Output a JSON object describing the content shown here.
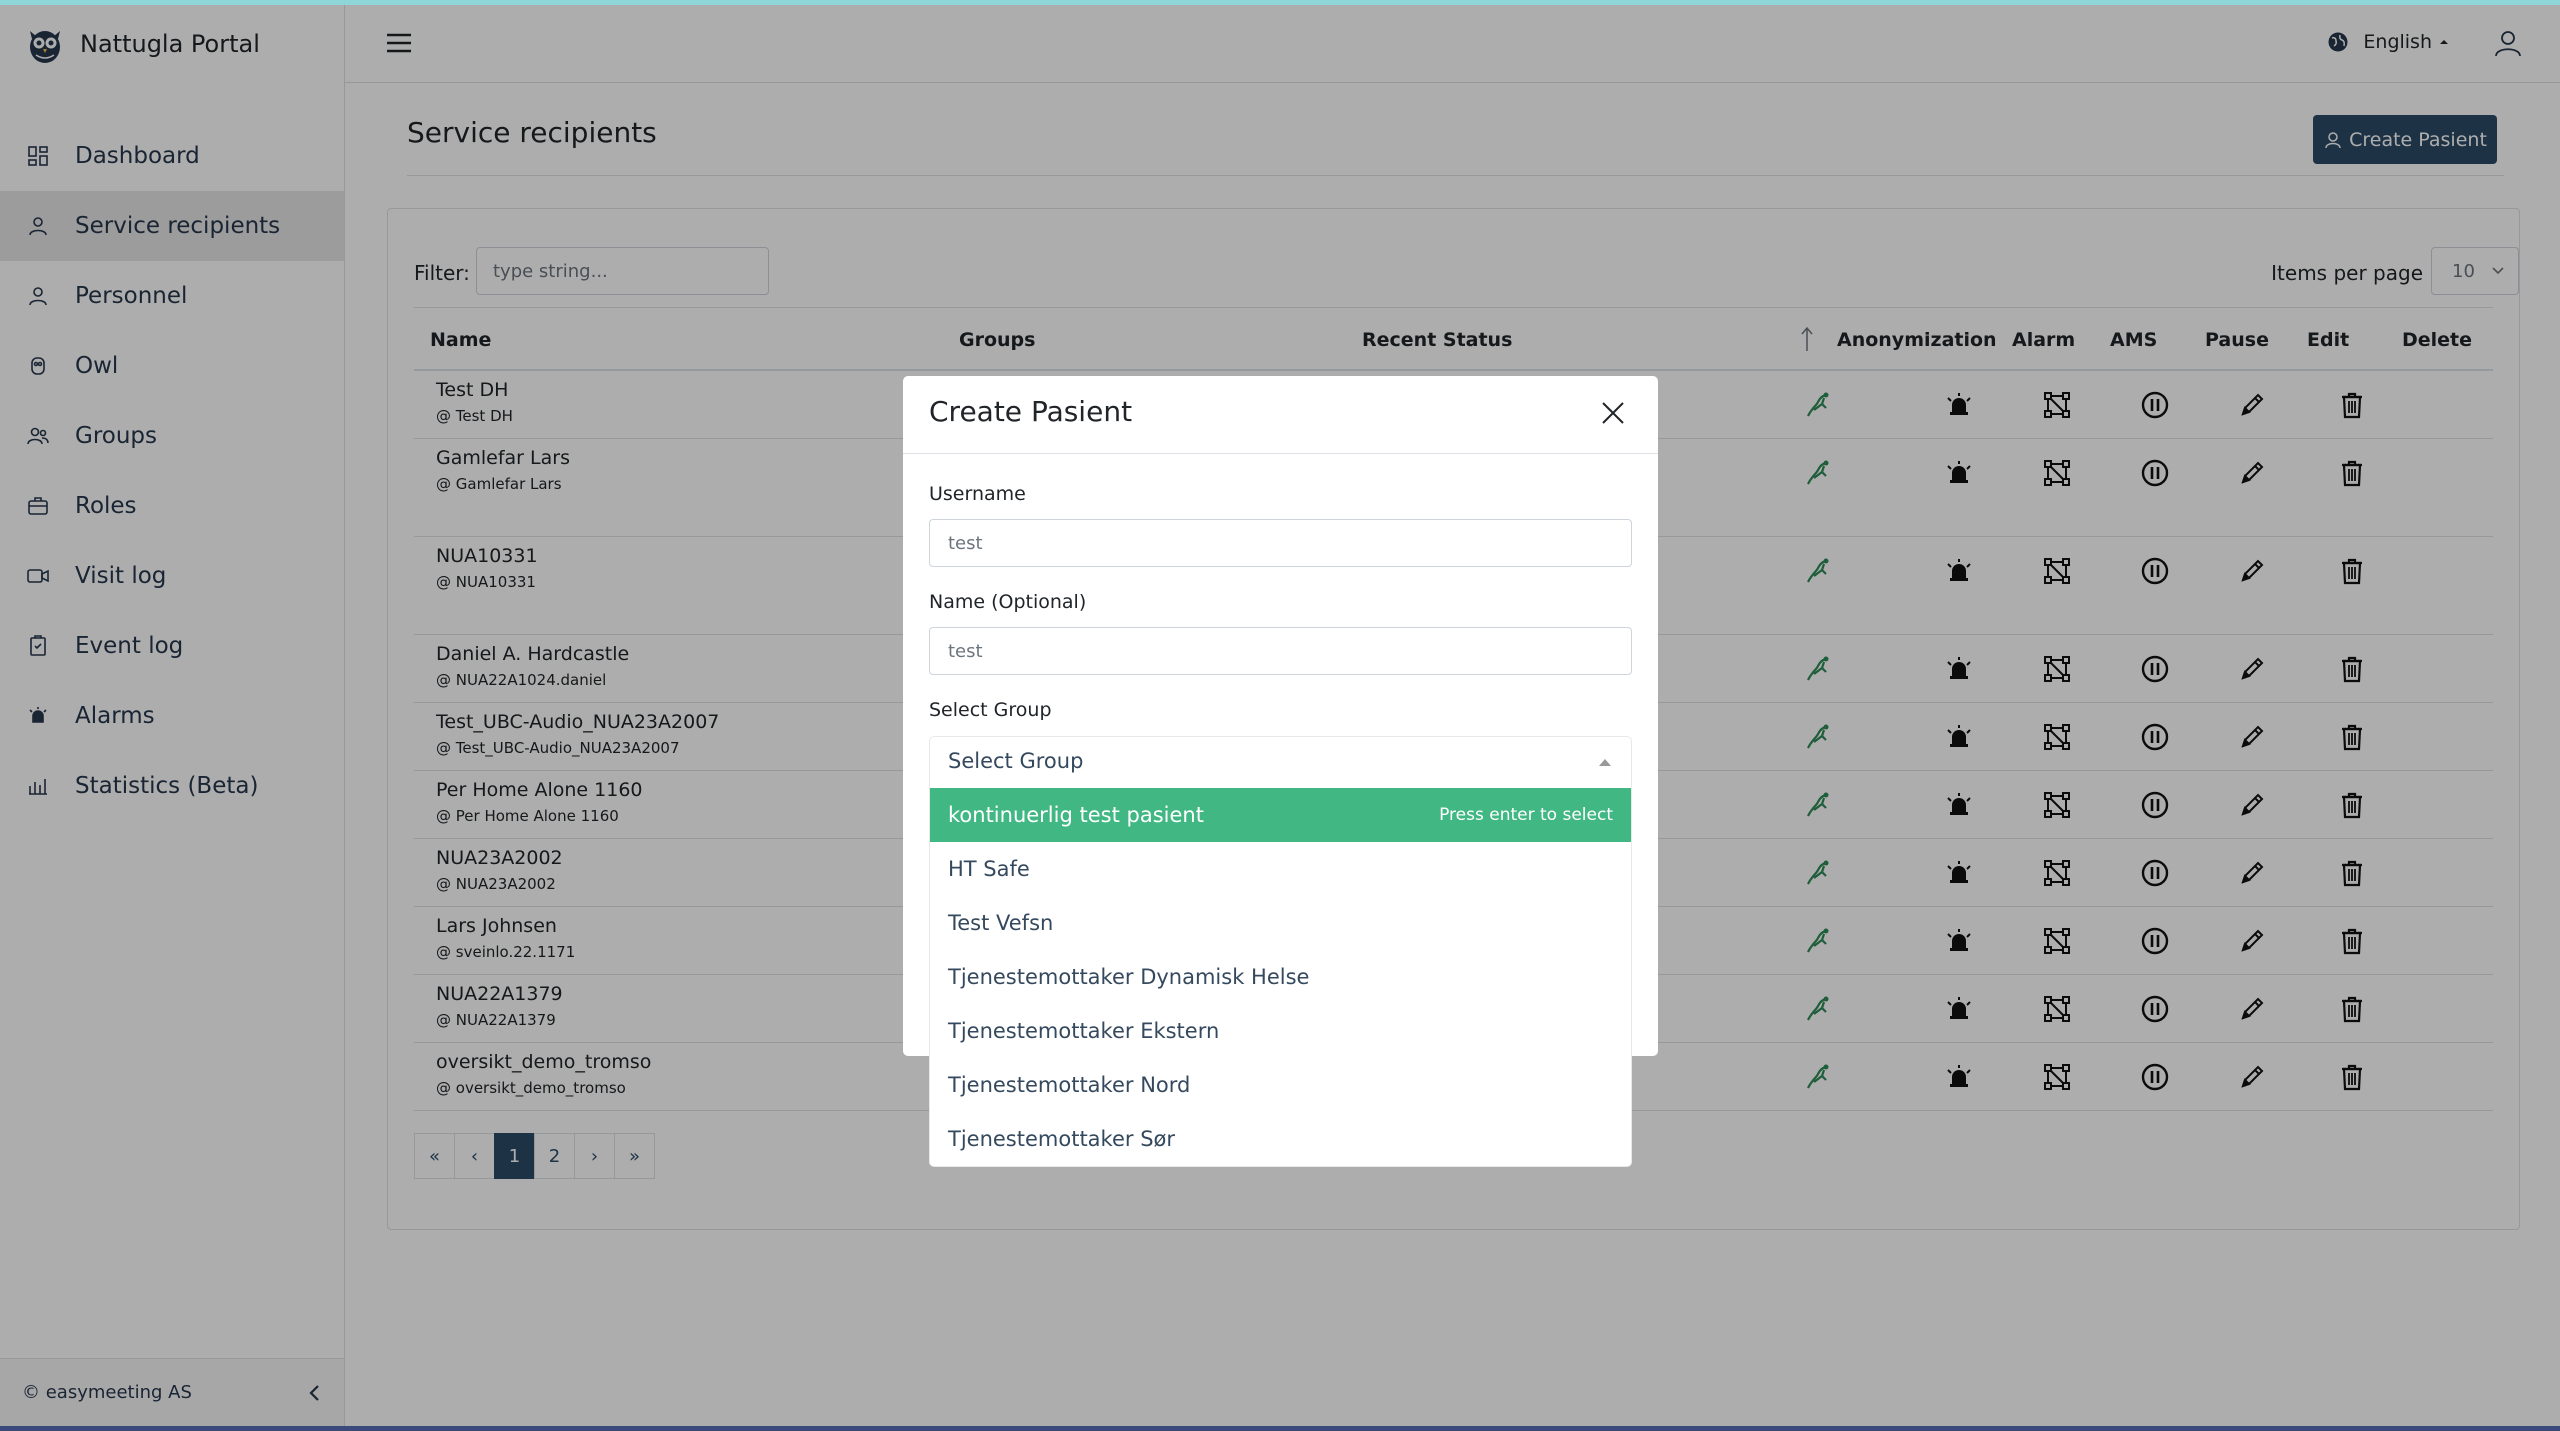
{
  "app": {
    "brand": "Nattugla Portal",
    "footer": "© easymeeting AS"
  },
  "sidebar": {
    "items": [
      {
        "label": "Dashboard",
        "icon": "dashboard-icon"
      },
      {
        "label": "Service recipients",
        "icon": "person-icon",
        "active": true
      },
      {
        "label": "Personnel",
        "icon": "person-icon"
      },
      {
        "label": "Owl",
        "icon": "owl-icon"
      },
      {
        "label": "Groups",
        "icon": "group-icon"
      },
      {
        "label": "Roles",
        "icon": "briefcase-icon"
      },
      {
        "label": "Visit log",
        "icon": "video-icon"
      },
      {
        "label": "Event log",
        "icon": "clipboard-icon"
      },
      {
        "label": "Alarms",
        "icon": "alarm-icon"
      },
      {
        "label": "Statistics (Beta)",
        "icon": "chart-icon"
      }
    ]
  },
  "header": {
    "language": "English"
  },
  "main": {
    "title": "Service recipients",
    "create_button": "Create Pasient",
    "filter_label": "Filter:",
    "filter_placeholder": "type string...",
    "items_per_page_label": "Items per page",
    "items_per_page_value": "10",
    "columns": [
      "Name",
      "Groups",
      "Recent Status",
      "Anonymization",
      "Alarm",
      "AMS",
      "Pause",
      "Edit",
      "Delete"
    ],
    "rows": [
      {
        "name": "Test DH",
        "username": "@ Test DH"
      },
      {
        "name": "Gamlefar Lars",
        "username": "@ Gamlefar Lars"
      },
      {
        "name": "NUA10331",
        "username": "@ NUA10331"
      },
      {
        "name": "Daniel A. Hardcastle",
        "username": "@ NUA22A1024.daniel"
      },
      {
        "name": "Test_UBC-Audio_NUA23A2007",
        "username": "@ Test_UBC-Audio_NUA23A2007"
      },
      {
        "name": "Per Home Alone 1160",
        "username": "@ Per Home Alone 1160"
      },
      {
        "name": "NUA23A2002",
        "username": "@ NUA23A2002"
      },
      {
        "name": "Lars Johnsen",
        "username": "@ sveinlo.22.1171"
      },
      {
        "name": "NUA22A1379",
        "username": "@ NUA22A1379"
      },
      {
        "name": "oversikt_demo_tromso",
        "username": "@ oversikt_demo_tromso"
      }
    ],
    "pagination": [
      "«",
      "‹",
      "1",
      "2",
      "›",
      "»"
    ]
  },
  "modal": {
    "title": "Create Pasient",
    "username_label": "Username",
    "username_value": "test",
    "name_label": "Name (Optional)",
    "name_value": "test",
    "group_label": "Select Group",
    "group_placeholder": "Select Group",
    "select_hint": "Press enter to select",
    "options": [
      "kontinuerlig test pasient",
      "HT Safe",
      "Test Vefsn",
      "Tjenestemottaker Dynamisk Helse",
      "Tjenestemottaker Ekstern",
      "Tjenestemottaker Nord",
      "Tjenestemottaker Sør"
    ]
  },
  "colors": {
    "accent": "#2b4a66",
    "highlight": "#41b883",
    "icon_green": "#2e8b57"
  }
}
